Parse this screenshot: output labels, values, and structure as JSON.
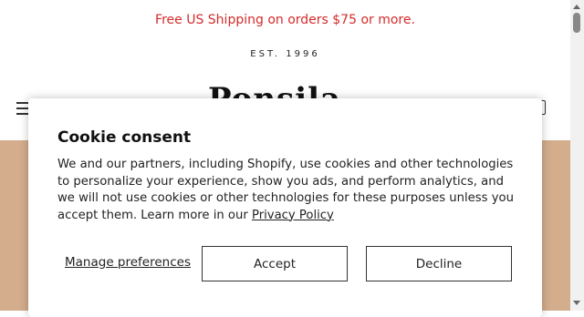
{
  "announcement": {
    "text": "Free US Shipping on orders $75 or more."
  },
  "header": {
    "est_text": "EST. 1996",
    "logo_text": "Ponsila"
  },
  "cookie": {
    "title": "Cookie consent",
    "body": "We and our partners, including Shopify, use cookies and other technologies to personalize your experience, show you ads, and perform analytics, and we will not use cookies or other technologies for these purposes unless you accept them. Learn more in our ",
    "privacy_link": "Privacy Policy",
    "manage_label": "Manage preferences",
    "accept_label": "Accept",
    "decline_label": "Decline"
  },
  "colors": {
    "announcement": "#d52b2b",
    "hero": "#d3ad8c"
  },
  "icons": {
    "menu": "hamburger-menu-icon",
    "cart": "cart-icon"
  }
}
